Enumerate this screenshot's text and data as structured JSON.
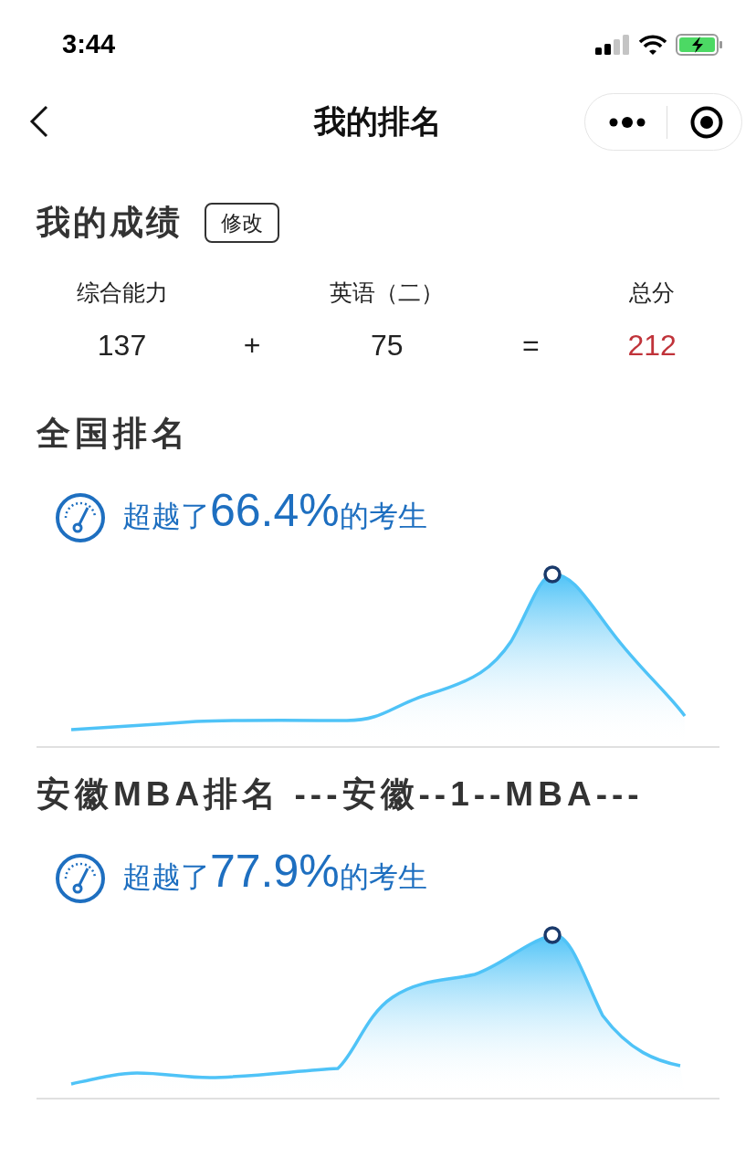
{
  "status_bar": {
    "time": "3:44"
  },
  "nav": {
    "title": "我的排名"
  },
  "scores": {
    "title": "我的成绩",
    "edit_button": "修改",
    "columns": [
      {
        "label": "综合能力",
        "value": "137",
        "kind": "score"
      },
      {
        "value": "+",
        "kind": "operator"
      },
      {
        "label": "英语（二）",
        "value": "75",
        "kind": "score"
      },
      {
        "value": "=",
        "kind": "operator"
      },
      {
        "label": "总分",
        "value": "212",
        "kind": "total"
      }
    ]
  },
  "rankings": [
    {
      "title": "全国排名",
      "prefix": "超越了",
      "percent": "66.4%",
      "suffix": "的考生"
    },
    {
      "title": "安徽MBA排名 ---安徽--1--MBA---",
      "prefix": "超越了",
      "percent": "77.9%",
      "suffix": "的考生"
    }
  ]
}
